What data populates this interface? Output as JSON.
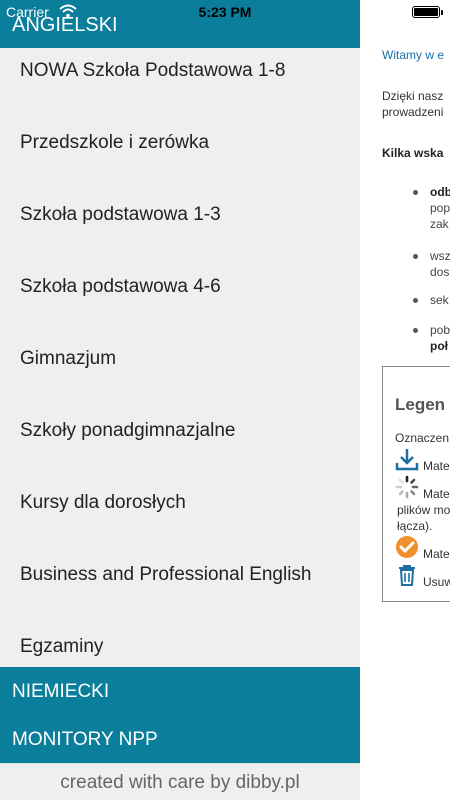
{
  "status_bar": {
    "carrier": "Carrier",
    "time": "5:23 PM"
  },
  "menu": {
    "header": "ANGIELSKI",
    "items": [
      "NOWA Szkoła Podstawowa 1-8",
      "Przedszkole i zerówka",
      "Szkoła podstawowa 1-3",
      "Szkoła podstawowa 4-6",
      "Gimnazjum",
      "Szkoły ponadgimnazjalne",
      "Kursy dla dorosłych",
      "Business and Professional English",
      "Egzaminy"
    ],
    "sections": [
      "NIEMIECKI",
      "MONITORY NPP"
    ],
    "footer": "created with care by dibby.pl"
  },
  "content": {
    "welcome": "Witamy w e",
    "intro_line1": "Dzięki nasz",
    "intro_line2": "prowadzeni",
    "tips_heading": "Kilka wska",
    "bullets": [
      {
        "line1": "odb",
        "line2": "pop",
        "line3": "zak"
      },
      {
        "line1": "wsz",
        "line2": "dos"
      },
      {
        "line1": "sek"
      },
      {
        "line1": "pob",
        "line2": "poł"
      }
    ],
    "legend": {
      "title": "Legen",
      "intro": "Oznaczen",
      "rows": [
        {
          "icon": "download-icon",
          "text": "Mate"
        },
        {
          "icon": "spinner-icon",
          "text": "Mate",
          "extra1": "plików mo",
          "extra2": "łącza)."
        },
        {
          "icon": "check-circle-icon",
          "text": "Mate"
        },
        {
          "icon": "trash-icon",
          "text": "Usuw"
        }
      ]
    },
    "colors": {
      "accent": "#0a7e9a",
      "link": "#1a6ea8",
      "check": "#f0902a",
      "icon_blue": "#1c6fa0"
    }
  }
}
